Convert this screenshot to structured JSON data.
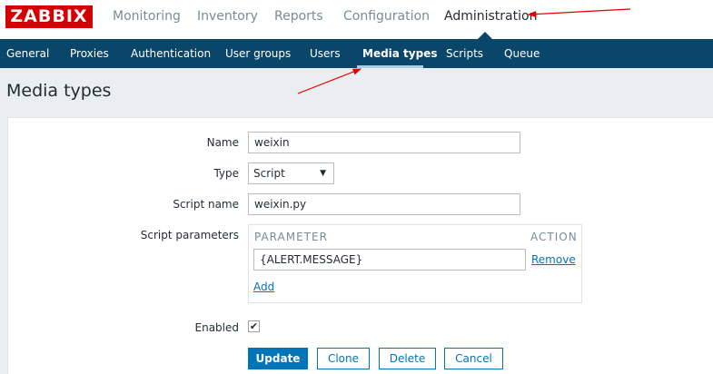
{
  "logo": "ZABBIX",
  "top_nav": [
    {
      "label": "Monitoring"
    },
    {
      "label": "Inventory"
    },
    {
      "label": "Reports"
    },
    {
      "label": "Configuration"
    },
    {
      "label": "Administration"
    }
  ],
  "sub_nav": [
    {
      "label": "General"
    },
    {
      "label": "Proxies"
    },
    {
      "label": "Authentication"
    },
    {
      "label": "User groups"
    },
    {
      "label": "Users"
    },
    {
      "label": "Media types"
    },
    {
      "label": "Scripts"
    },
    {
      "label": "Queue"
    }
  ],
  "page_title": "Media types",
  "form": {
    "name_label": "Name",
    "name_value": "weixin",
    "type_label": "Type",
    "type_value": "Script",
    "script_name_label": "Script name",
    "script_name_value": "weixin.py",
    "script_params_label": "Script parameters",
    "param_col": "PARAMETER",
    "action_col": "ACTION",
    "param_value": "{ALERT.MESSAGE}",
    "remove_link": "Remove",
    "add_link": "Add",
    "enabled_label": "Enabled",
    "enabled_checked": true
  },
  "buttons": {
    "update": "Update",
    "clone": "Clone",
    "delete": "Delete",
    "cancel": "Cancel"
  },
  "colors": {
    "brand_red": "#d40000",
    "subnav_bg": "#0a466a",
    "accent_blue": "#0275b8",
    "annotation_red": "#e00000"
  }
}
